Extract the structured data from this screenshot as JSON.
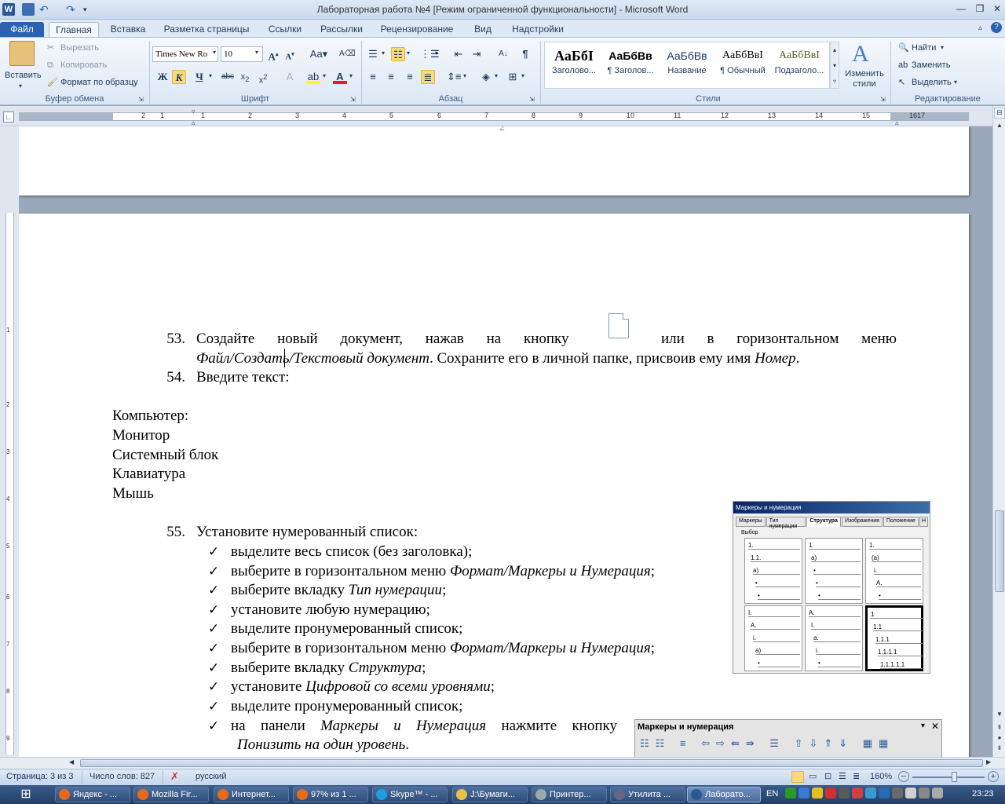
{
  "window": {
    "title": "Лабораторная работа №4 [Режим ограниченной функциональности]  -  Microsoft Word",
    "app_icon": "W"
  },
  "tabs": [
    "Файл",
    "Главная",
    "Вставка",
    "Разметка страницы",
    "Ссылки",
    "Рассылки",
    "Рецензирование",
    "Вид",
    "Надстройки"
  ],
  "clipboard": {
    "paste": "Вставить",
    "cut": "Вырезать",
    "copy": "Копировать",
    "format_painter": "Формат по образцу",
    "group": "Буфер обмена"
  },
  "font": {
    "family": "Times New Ro",
    "size": "10",
    "bold": "Ж",
    "italic": "К",
    "underline": "Ч",
    "group": "Шрифт"
  },
  "paragraph": {
    "group": "Абзац"
  },
  "styles": {
    "items": [
      {
        "preview": "АаБбІ",
        "label": "Заголово..."
      },
      {
        "preview": "АаБбВв",
        "label": "¶ Заголов..."
      },
      {
        "preview": "АаБбВв",
        "label": "Название"
      },
      {
        "preview": "АаБбВвІ",
        "label": "¶ Обычный"
      },
      {
        "preview": "АаБбВвІ",
        "label": "Подзаголо..."
      }
    ],
    "change_styles": "Изменить стили",
    "group": "Стили"
  },
  "editing": {
    "find": "Найти",
    "replace": "Заменить",
    "select": "Выделить",
    "group": "Редактирование"
  },
  "ruler": {
    "numbers": [
      "2",
      "1",
      "1",
      "2",
      "3",
      "4",
      "5",
      "6",
      "7",
      "8",
      "9",
      "10",
      "11",
      "12",
      "13",
      "14",
      "15",
      "16",
      "17"
    ]
  },
  "document": {
    "page_number_top": "2",
    "item53_num": "53.",
    "item53_words": [
      "Создайте",
      "новый",
      "документ,",
      "нажав",
      "на",
      "кнопку",
      "или",
      "в",
      "горизонтальном",
      "меню"
    ],
    "item53_line2_italic1": "Файл/Создать/Текстовый документ",
    "item53_line2_normal": ". Сохраните его в личной папке, присвоив ему имя ",
    "item53_line2_italic2": "Номер",
    "item53_line2_end": ".",
    "item54_num": "54.",
    "item54_text": "Введите текст:",
    "list_lines": [
      "Компьютер:",
      "Монитор",
      "Системный блок",
      "Клавиатура",
      "Мышь"
    ],
    "item55_num": "55.",
    "item55_text": "Установите нумерованный список:",
    "checks": [
      {
        "normal": "выделите весь список (без заголовка);",
        "italic": "",
        "end": ""
      },
      {
        "normal": "выберите в горизонтальном меню ",
        "italic": "Формат/Маркеры и Нумерация",
        "end": ";"
      },
      {
        "normal": "выберите вкладку ",
        "italic": "Тип нумерации",
        "end": ";"
      },
      {
        "normal": "установите любую нумерацию;",
        "italic": "",
        "end": ""
      },
      {
        "normal": "выделите пронумерованный список;",
        "italic": "",
        "end": ""
      },
      {
        "normal": "выберите в горизонтальном меню ",
        "italic": "Формат/Маркеры и Нумерация",
        "end": ";"
      },
      {
        "normal": "выберите вкладку ",
        "italic": "Структура",
        "end": ";"
      },
      {
        "normal": "установите ",
        "italic": "Цифровой со всеми уровнями",
        "end": ";"
      },
      {
        "normal": "выделите пронумерованный список;",
        "italic": "",
        "end": ""
      }
    ],
    "last_check_words": [
      "на",
      "панели"
    ],
    "last_check_italic": [
      "Маркеры",
      "и",
      "Нумерация"
    ],
    "last_check_tail": [
      "нажмите",
      "кнопку"
    ],
    "last_check_line2_italic": "Понизить на один уровень",
    "last_check_line2_end": "."
  },
  "dialog_image": {
    "title": "Маркеры и нумерация",
    "tabs": [
      "Маркеры",
      "Тип нумерации",
      "Структура",
      "Изображения",
      "Положение",
      "Н"
    ],
    "group": "Выбор",
    "cells": [
      [
        "1.",
        "1.1.",
        "a)",
        "•",
        "•"
      ],
      [
        "1.",
        "a)",
        "•",
        "•",
        "•"
      ],
      [
        "1.",
        "(a)",
        "i.",
        "A.",
        "•"
      ],
      [
        "I.",
        "A.",
        "i.",
        "a)",
        "•"
      ],
      [
        "A.",
        "I.",
        "a.",
        "i.",
        "•"
      ],
      [
        "1",
        "1.1",
        "1.1.1",
        "1.1.1.1",
        "1.1.1.1.1"
      ]
    ]
  },
  "toolbar_image": {
    "title": "Маркеры и нумерация"
  },
  "status": {
    "page": "Страница: 3 из 3",
    "words": "Число слов: 827",
    "language": "русский",
    "zoom": "160%"
  },
  "taskbar": {
    "items": [
      "Яндекс - ...",
      "Mozilla Fir...",
      "Интернет...",
      "97% из 1 ...",
      "Skype™ - ...",
      "J:\\Бумаги...",
      "Принтер...",
      "Утилита ...",
      "Лаборато..."
    ],
    "lang": "EN",
    "clock": "23:23"
  }
}
